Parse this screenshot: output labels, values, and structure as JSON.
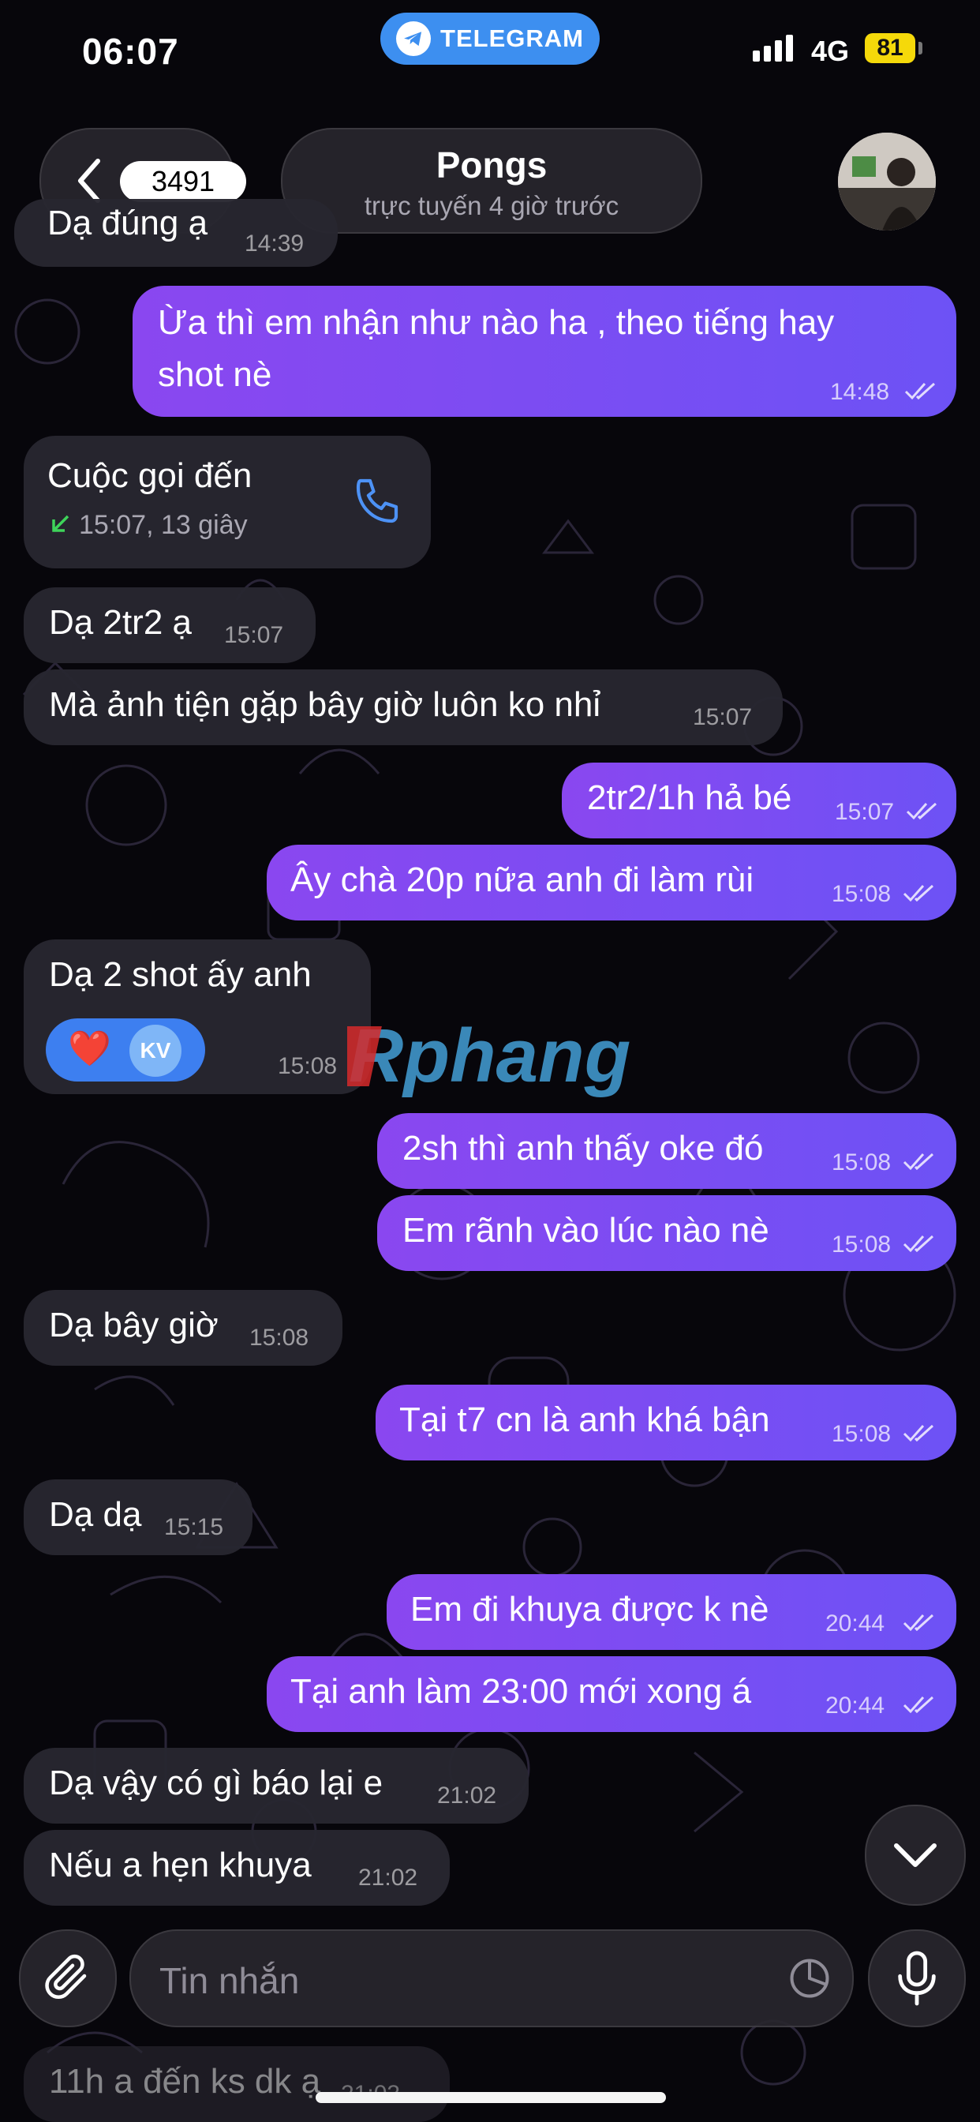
{
  "status_bar": {
    "time": "06:07",
    "network": "4G",
    "battery": "81",
    "app_pill": "TELEGRAM"
  },
  "header": {
    "back_count": "3491",
    "chat_name": "Pongs",
    "chat_status": "trực tuyến 4 giờ trước"
  },
  "messages": [
    {
      "dir": "in",
      "text": "Dạ đúng ạ",
      "time": "14:39"
    },
    {
      "dir": "out",
      "lines": [
        "Ừa thì em nhận như nào ha , theo tiếng hay",
        "shot nè"
      ],
      "time": "14:48"
    },
    {
      "dir": "in",
      "type": "call",
      "title": "Cuộc gọi đến",
      "detail": "15:07, 13 giây"
    },
    {
      "dir": "in",
      "text": "Dạ 2tr2 ạ",
      "time": "15:07"
    },
    {
      "dir": "in",
      "text": "Mà ảnh tiện gặp bây giờ luôn ko nhỉ",
      "time": "15:07"
    },
    {
      "dir": "out",
      "text": "2tr2/1h hả bé",
      "time": "15:07"
    },
    {
      "dir": "out",
      "text": "Ây chà 20p nữa anh đi làm rùi",
      "time": "15:08"
    },
    {
      "dir": "in",
      "text": "Dạ 2 shot ấy anh",
      "time": "15:08",
      "reaction": {
        "emoji": "❤️",
        "user_initials": "KV"
      }
    },
    {
      "dir": "out",
      "text": "2sh thì anh thấy oke đó",
      "time": "15:08"
    },
    {
      "dir": "out",
      "text": "Em rãnh vào lúc nào nè",
      "time": "15:08"
    },
    {
      "dir": "in",
      "text": "Dạ bây giờ",
      "time": "15:08"
    },
    {
      "dir": "out",
      "text": "Tại t7 cn là anh khá bận",
      "time": "15:08"
    },
    {
      "dir": "in",
      "text": "Dạ dạ",
      "time": "15:15"
    },
    {
      "dir": "out",
      "text": "Em đi khuya được k nè",
      "time": "20:44"
    },
    {
      "dir": "out",
      "text": "Tại anh làm 23:00 mới xong á",
      "time": "20:44"
    },
    {
      "dir": "in",
      "text": "Dạ vậy có gì báo lại e",
      "time": "21:02"
    },
    {
      "dir": "in",
      "text": "Nếu a hẹn khuya",
      "time": "21:02"
    },
    {
      "dir": "in",
      "text": "11h a đến ks dk ạ",
      "time": "21:03"
    }
  ],
  "watermark": "Rphang",
  "composer": {
    "placeholder": "Tin nhắn"
  },
  "icons": [
    "back-chevron-icon",
    "telegram-plane-icon",
    "phone-icon",
    "call-incoming-arrow-icon",
    "read-ticks-icon",
    "heart-icon",
    "chevron-down-icon",
    "paperclip-icon",
    "sticker-icon",
    "microphone-icon"
  ],
  "colors": {
    "outgoing_bubble": "#7b4ef3",
    "incoming_bubble": "#28262f",
    "accent_blue": "#3d8ff0",
    "battery": "#f5d90a"
  }
}
